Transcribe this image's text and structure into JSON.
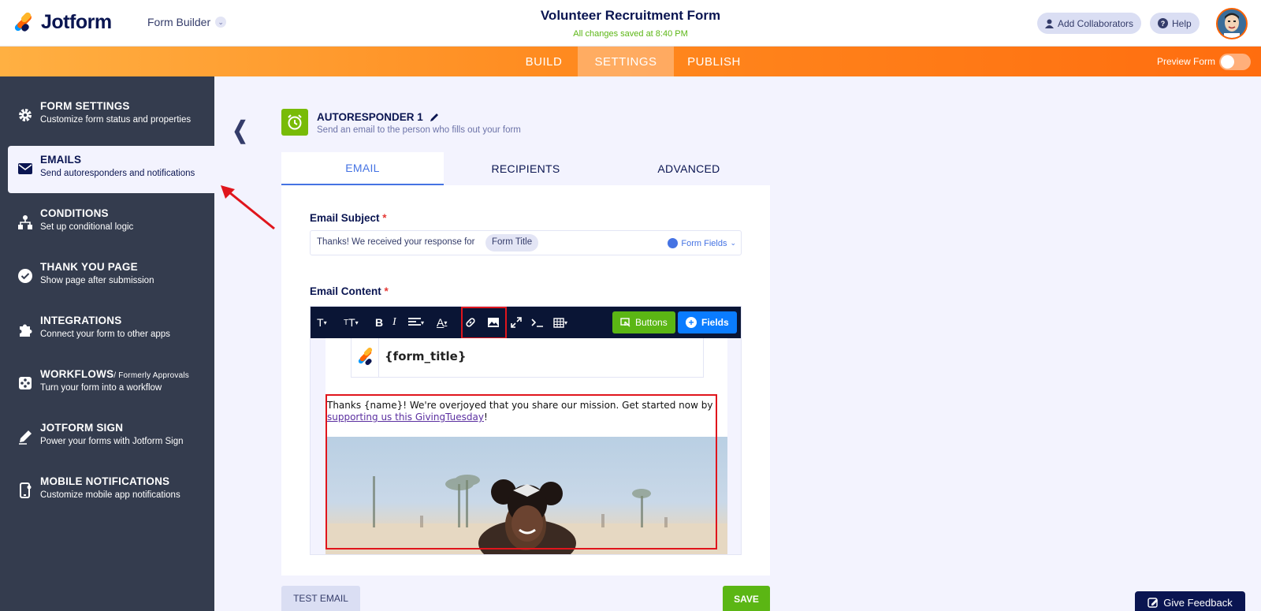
{
  "header": {
    "brand": "Jotform",
    "builder_label": "Form Builder",
    "form_title": "Volunteer Recruitment Form",
    "saved_status": "All changes saved at 8:40 PM",
    "add_collaborators": "Add Collaborators",
    "help": "Help"
  },
  "nav": {
    "tabs": [
      "BUILD",
      "SETTINGS",
      "PUBLISH"
    ],
    "active_tab": "SETTINGS",
    "preview_label": "Preview Form",
    "preview_on": false
  },
  "sidebar": {
    "items": [
      {
        "title": "FORM SETTINGS",
        "sub": "Customize form status and properties",
        "icon": "gear-icon"
      },
      {
        "title": "EMAILS",
        "sub": "Send autoresponders and notifications",
        "icon": "envelope-icon"
      },
      {
        "title": "CONDITIONS",
        "sub": "Set up conditional logic",
        "icon": "hierarchy-icon"
      },
      {
        "title": "THANK YOU PAGE",
        "sub": "Show page after submission",
        "icon": "check-circle-icon"
      },
      {
        "title": "INTEGRATIONS",
        "sub": "Connect your form to other apps",
        "icon": "puzzle-icon"
      },
      {
        "title": "WORKFLOWS",
        "title_note": "/ Formerly Approvals",
        "sub": "Turn your form into a workflow",
        "icon": "workflow-icon"
      },
      {
        "title": "JOTFORM SIGN",
        "sub": "Power your forms with Jotform Sign",
        "icon": "pen-icon"
      },
      {
        "title": "MOBILE NOTIFICATIONS",
        "sub": "Customize mobile app notifications",
        "icon": "mobile-icon"
      }
    ],
    "active_index": 1
  },
  "autoresponder": {
    "title": "AUTORESPONDER 1",
    "subtitle": "Send an email to the person who fills out your form"
  },
  "tabs": [
    "EMAIL",
    "RECIPIENTS",
    "ADVANCED"
  ],
  "email": {
    "subject_label": "Email Subject",
    "subject_text": "Thanks! We received your response for",
    "subject_chip": "Form Title",
    "form_fields_label": "Form Fields",
    "content_label": "Email Content",
    "required_mark": "*",
    "toolbar": {
      "buttons_label": "Buttons",
      "fields_label": "Fields"
    },
    "body": {
      "form_title_var": "{form_title}",
      "text": "Thanks {name}! We're overjoyed that you share our mission. Get started now by",
      "link": "supporting us this GivingTuesday",
      "after_link": "!"
    }
  },
  "footer": {
    "test_email": "TEST EMAIL",
    "save": "SAVE",
    "feedback": "Give Feedback"
  },
  "colors": {
    "accent": "#4573e3",
    "orange": "#ff6100",
    "green": "#5bb614",
    "highlight": "#e0151c",
    "sidebar": "#343c4e"
  }
}
